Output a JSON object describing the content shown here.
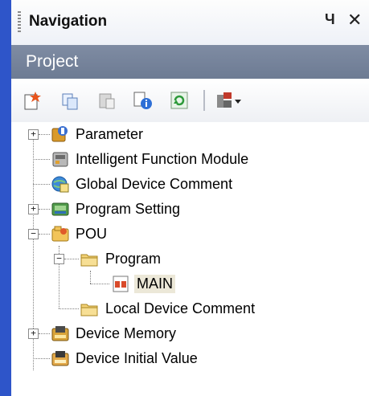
{
  "window": {
    "title": "Navigation"
  },
  "header": {
    "pin_glyph": "Ч",
    "close_glyph": "✕"
  },
  "section": {
    "title": "Project"
  },
  "toolbar": {
    "buttons": [
      {
        "name": "new-data-icon"
      },
      {
        "name": "copy-icon"
      },
      {
        "name": "paste-icon"
      },
      {
        "name": "properties-icon"
      },
      {
        "name": "refresh-icon"
      },
      {
        "name": "tool-dropdown-icon"
      }
    ]
  },
  "tree": {
    "items": [
      {
        "label": "Parameter",
        "icon": "parameter-icon",
        "expander": "+"
      },
      {
        "label": "Intelligent Function Module",
        "icon": "module-icon"
      },
      {
        "label": "Global Device Comment",
        "icon": "global-comment-icon"
      },
      {
        "label": "Program Setting",
        "icon": "program-setting-icon",
        "expander": "+"
      },
      {
        "label": "POU",
        "icon": "pou-icon",
        "expander": "−"
      },
      {
        "label": "Program",
        "icon": "folder-icon",
        "expander": "−"
      },
      {
        "label": "MAIN",
        "icon": "program-file-icon",
        "selected": true
      },
      {
        "label": "Local Device Comment",
        "icon": "folder-icon"
      },
      {
        "label": "Device Memory",
        "icon": "device-memory-icon",
        "expander": "+"
      },
      {
        "label": "Device Initial Value",
        "icon": "device-initial-value-icon"
      }
    ]
  },
  "colors": {
    "accent": "#2e55c9",
    "project_bar": "#75839b",
    "selection": "#ece8d8"
  }
}
